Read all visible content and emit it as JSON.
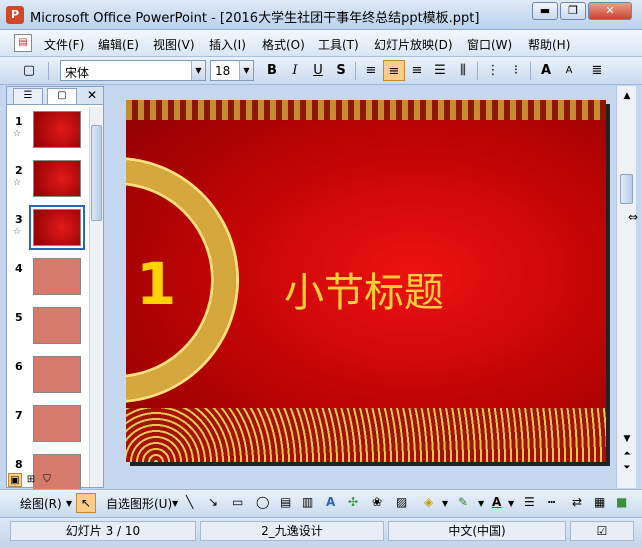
{
  "window": {
    "title": "Microsoft Office PowerPoint - [2016大学生社团干事年终总结ppt模板.ppt]",
    "min_glyph": "▬",
    "max_glyph": "❐",
    "close_glyph": "✕"
  },
  "menu": {
    "items": [
      "文件(F)",
      "编辑(E)",
      "视图(V)",
      "插入(I)",
      "格式(O)",
      "工具(T)",
      "幻灯片放映(D)",
      "窗口(W)",
      "帮助(H)"
    ]
  },
  "toolbar": {
    "font_name": "宋体",
    "font_size": "18",
    "bold_glyph": "B",
    "italic_glyph": "I",
    "underline_glyph": "U",
    "shadow_glyph": "S",
    "grow_glyph": "A",
    "shrink_glyph": "A"
  },
  "outline_pane": {
    "close_glyph": "✕",
    "slides": [
      {
        "number": "1",
        "style": "red",
        "star": true
      },
      {
        "number": "2",
        "style": "red",
        "star": true
      },
      {
        "number": "3",
        "style": "red",
        "star": true,
        "selected": true
      },
      {
        "number": "4",
        "style": "pink",
        "star": false
      },
      {
        "number": "5",
        "style": "pink",
        "star": false
      },
      {
        "number": "6",
        "style": "pink",
        "star": false
      },
      {
        "number": "7",
        "style": "pink",
        "star": false
      },
      {
        "number": "8",
        "style": "pink",
        "star": false
      }
    ]
  },
  "slide": {
    "number": "1",
    "title": "小节标题"
  },
  "drawing_toolbar": {
    "draw_label": "绘图(R)",
    "autoshape_label": "自选图形(U)"
  },
  "status": {
    "slide_position": "幻灯片 3 / 10",
    "design": "2_九逸设计",
    "language": "中文(中国)"
  },
  "colors": {
    "slide_red": "#c40505",
    "title_gold": "#ffcf3a",
    "number_yellow": "#ffd200",
    "selection": "#2d66b6"
  }
}
